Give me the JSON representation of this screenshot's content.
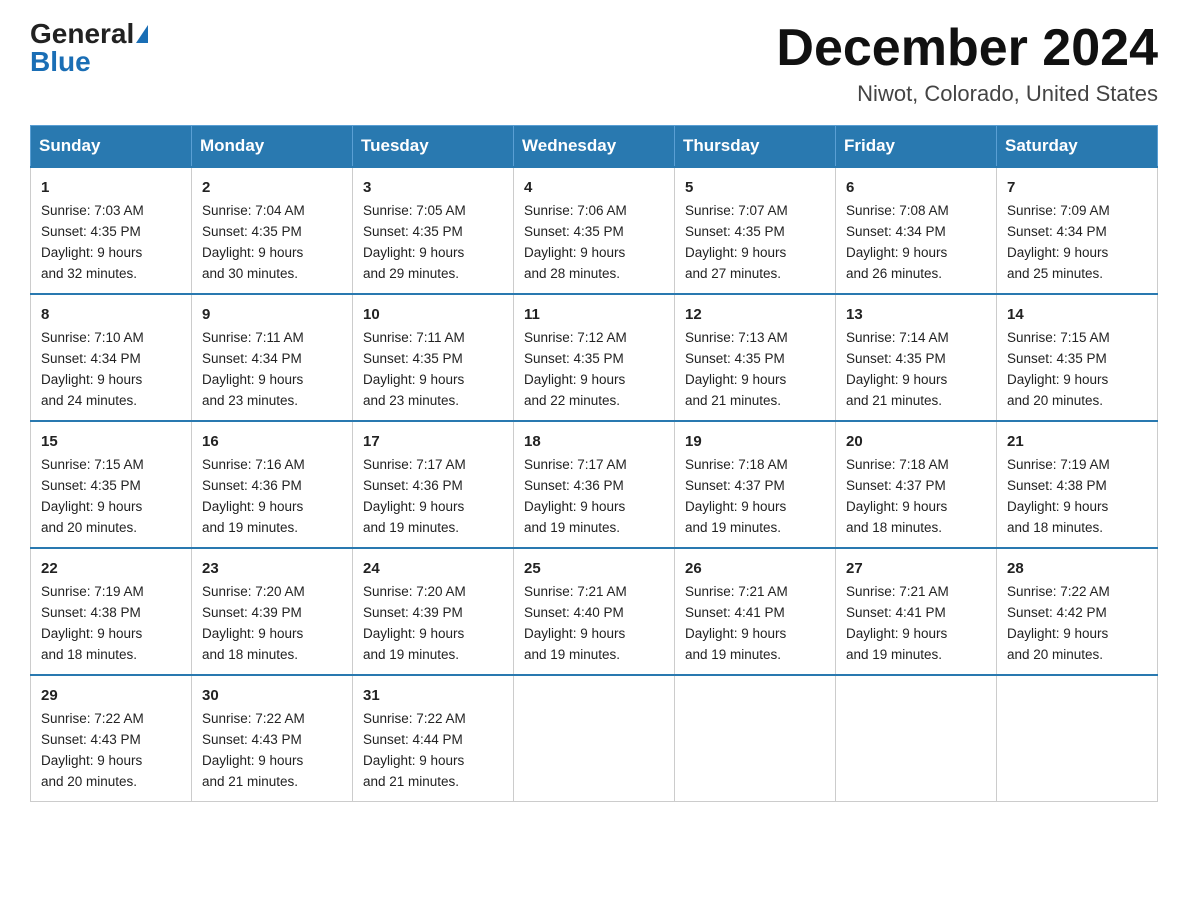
{
  "header": {
    "logo_general": "General",
    "logo_blue": "Blue",
    "month_title": "December 2024",
    "location": "Niwot, Colorado, United States"
  },
  "days_of_week": [
    "Sunday",
    "Monday",
    "Tuesday",
    "Wednesday",
    "Thursday",
    "Friday",
    "Saturday"
  ],
  "weeks": [
    [
      {
        "day": "1",
        "sunrise": "7:03 AM",
        "sunset": "4:35 PM",
        "daylight": "9 hours and 32 minutes."
      },
      {
        "day": "2",
        "sunrise": "7:04 AM",
        "sunset": "4:35 PM",
        "daylight": "9 hours and 30 minutes."
      },
      {
        "day": "3",
        "sunrise": "7:05 AM",
        "sunset": "4:35 PM",
        "daylight": "9 hours and 29 minutes."
      },
      {
        "day": "4",
        "sunrise": "7:06 AM",
        "sunset": "4:35 PM",
        "daylight": "9 hours and 28 minutes."
      },
      {
        "day": "5",
        "sunrise": "7:07 AM",
        "sunset": "4:35 PM",
        "daylight": "9 hours and 27 minutes."
      },
      {
        "day": "6",
        "sunrise": "7:08 AM",
        "sunset": "4:34 PM",
        "daylight": "9 hours and 26 minutes."
      },
      {
        "day": "7",
        "sunrise": "7:09 AM",
        "sunset": "4:34 PM",
        "daylight": "9 hours and 25 minutes."
      }
    ],
    [
      {
        "day": "8",
        "sunrise": "7:10 AM",
        "sunset": "4:34 PM",
        "daylight": "9 hours and 24 minutes."
      },
      {
        "day": "9",
        "sunrise": "7:11 AM",
        "sunset": "4:34 PM",
        "daylight": "9 hours and 23 minutes."
      },
      {
        "day": "10",
        "sunrise": "7:11 AM",
        "sunset": "4:35 PM",
        "daylight": "9 hours and 23 minutes."
      },
      {
        "day": "11",
        "sunrise": "7:12 AM",
        "sunset": "4:35 PM",
        "daylight": "9 hours and 22 minutes."
      },
      {
        "day": "12",
        "sunrise": "7:13 AM",
        "sunset": "4:35 PM",
        "daylight": "9 hours and 21 minutes."
      },
      {
        "day": "13",
        "sunrise": "7:14 AM",
        "sunset": "4:35 PM",
        "daylight": "9 hours and 21 minutes."
      },
      {
        "day": "14",
        "sunrise": "7:15 AM",
        "sunset": "4:35 PM",
        "daylight": "9 hours and 20 minutes."
      }
    ],
    [
      {
        "day": "15",
        "sunrise": "7:15 AM",
        "sunset": "4:35 PM",
        "daylight": "9 hours and 20 minutes."
      },
      {
        "day": "16",
        "sunrise": "7:16 AM",
        "sunset": "4:36 PM",
        "daylight": "9 hours and 19 minutes."
      },
      {
        "day": "17",
        "sunrise": "7:17 AM",
        "sunset": "4:36 PM",
        "daylight": "9 hours and 19 minutes."
      },
      {
        "day": "18",
        "sunrise": "7:17 AM",
        "sunset": "4:36 PM",
        "daylight": "9 hours and 19 minutes."
      },
      {
        "day": "19",
        "sunrise": "7:18 AM",
        "sunset": "4:37 PM",
        "daylight": "9 hours and 19 minutes."
      },
      {
        "day": "20",
        "sunrise": "7:18 AM",
        "sunset": "4:37 PM",
        "daylight": "9 hours and 18 minutes."
      },
      {
        "day": "21",
        "sunrise": "7:19 AM",
        "sunset": "4:38 PM",
        "daylight": "9 hours and 18 minutes."
      }
    ],
    [
      {
        "day": "22",
        "sunrise": "7:19 AM",
        "sunset": "4:38 PM",
        "daylight": "9 hours and 18 minutes."
      },
      {
        "day": "23",
        "sunrise": "7:20 AM",
        "sunset": "4:39 PM",
        "daylight": "9 hours and 18 minutes."
      },
      {
        "day": "24",
        "sunrise": "7:20 AM",
        "sunset": "4:39 PM",
        "daylight": "9 hours and 19 minutes."
      },
      {
        "day": "25",
        "sunrise": "7:21 AM",
        "sunset": "4:40 PM",
        "daylight": "9 hours and 19 minutes."
      },
      {
        "day": "26",
        "sunrise": "7:21 AM",
        "sunset": "4:41 PM",
        "daylight": "9 hours and 19 minutes."
      },
      {
        "day": "27",
        "sunrise": "7:21 AM",
        "sunset": "4:41 PM",
        "daylight": "9 hours and 19 minutes."
      },
      {
        "day": "28",
        "sunrise": "7:22 AM",
        "sunset": "4:42 PM",
        "daylight": "9 hours and 20 minutes."
      }
    ],
    [
      {
        "day": "29",
        "sunrise": "7:22 AM",
        "sunset": "4:43 PM",
        "daylight": "9 hours and 20 minutes."
      },
      {
        "day": "30",
        "sunrise": "7:22 AM",
        "sunset": "4:43 PM",
        "daylight": "9 hours and 21 minutes."
      },
      {
        "day": "31",
        "sunrise": "7:22 AM",
        "sunset": "4:44 PM",
        "daylight": "9 hours and 21 minutes."
      },
      null,
      null,
      null,
      null
    ]
  ],
  "labels": {
    "sunrise": "Sunrise:",
    "sunset": "Sunset:",
    "daylight": "Daylight:"
  }
}
